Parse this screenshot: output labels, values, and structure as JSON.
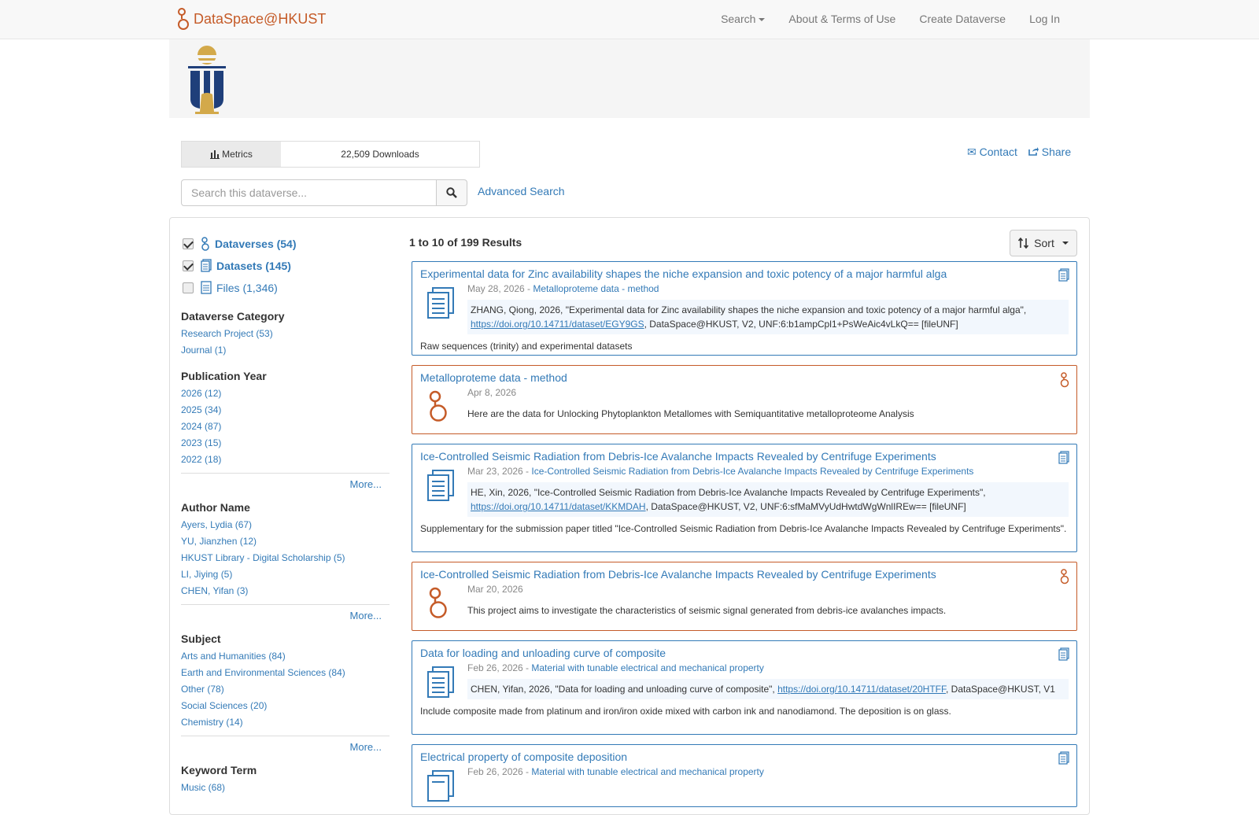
{
  "navbar": {
    "brand": "DataSpace@HKUST",
    "items": [
      "Search",
      "About & Terms of Use",
      "Create Dataverse",
      "Log In"
    ]
  },
  "metrics": {
    "label": "Metrics",
    "downloads": "22,509 Downloads"
  },
  "actions": {
    "contact": "Contact",
    "share": "Share"
  },
  "search": {
    "placeholder": "Search this dataverse...",
    "advanced": "Advanced Search"
  },
  "types": [
    {
      "label": "Dataverses (54)",
      "checked": true
    },
    {
      "label": "Datasets (145)",
      "checked": true
    },
    {
      "label": "Files (1,346)",
      "checked": false
    }
  ],
  "facets": [
    {
      "title": "Dataverse Category",
      "items": [
        "Research Project (53)",
        "Journal (1)"
      ],
      "more": ""
    },
    {
      "title": "Publication Year",
      "items": [
        "2026 (12)",
        "2025 (34)",
        "2024 (87)",
        "2023 (15)",
        "2022 (18)"
      ],
      "more": "More..."
    },
    {
      "title": "Author Name",
      "items": [
        "Ayers, Lydia (67)",
        "YU, Jianzhen (12)",
        "HKUST Library - Digital Scholarship (5)",
        "LI, Jiying (5)",
        "CHEN, Yifan (3)"
      ],
      "more": "More..."
    },
    {
      "title": "Subject",
      "items": [
        "Arts and Humanities (84)",
        "Earth and Environmental Sciences (84)",
        "Other (78)",
        "Social Sciences (20)",
        "Chemistry (14)"
      ],
      "more": "More..."
    },
    {
      "title": "Keyword Term",
      "items": [
        "Music (68)"
      ],
      "more": ""
    }
  ],
  "results": {
    "count": "1 to 10 of 199 Results",
    "sort": "Sort",
    "items": [
      {
        "kind": "dataset",
        "title": "Experimental data for Zinc availability shapes the niche expansion and toxic potency of a major harmful alga",
        "date": "May 28, 2026 - ",
        "parent": "Metalloproteme data - method",
        "cite_pre": "ZHANG, Qiong, 2026, \"Experimental data for Zinc availability shapes the niche expansion and toxic potency of a major harmful alga\", ",
        "doi": "https://doi.org/10.14711/dataset/EGY9GS",
        "cite_post": ", DataSpace@HKUST, V2, UNF:6:b1ampCpl1+PsWeAic4vLkQ== [fileUNF]",
        "desc": "Raw sequences (trinity) and experimental datasets"
      },
      {
        "kind": "dataverse",
        "title": "Metalloproteme data - method",
        "date": "Apr 8, 2026",
        "desc": "Here are the data for Unlocking Phytoplankton Metallomes with Semiquantitative metalloproteome Analysis"
      },
      {
        "kind": "dataset",
        "title": "Ice-Controlled Seismic Radiation from Debris-Ice Avalanche Impacts Revealed by Centrifuge Experiments",
        "date": "Mar 23, 2026 - ",
        "parent": "Ice-Controlled Seismic Radiation from Debris-Ice Avalanche Impacts Revealed by Centrifuge Experiments",
        "cite_pre": "HE, Xin, 2026, \"Ice-Controlled Seismic Radiation from Debris-Ice Avalanche Impacts Revealed by Centrifuge Experiments\", ",
        "doi": "https://doi.org/10.14711/dataset/KKMDAH",
        "cite_post": ", DataSpace@HKUST, V2, UNF:6:sfMaMVyUdHwtdWgWnlIREw== [fileUNF]",
        "desc": "Supplementary for the submission paper titled \"Ice-Controlled Seismic Radiation from Debris-Ice Avalanche Impacts Revealed by Centrifuge Experiments\"."
      },
      {
        "kind": "dataverse",
        "title": "Ice-Controlled Seismic Radiation from Debris-Ice Avalanche Impacts Revealed by Centrifuge Experiments",
        "date": "Mar 20, 2026",
        "desc": "This project aims to investigate the characteristics of seismic signal generated from debris-ice avalanches impacts."
      },
      {
        "kind": "dataset",
        "title": "Data for loading and unloading curve of composite",
        "date": "Feb 26, 2026 - ",
        "parent": "Material with tunable electrical and mechanical property",
        "cite_pre": "CHEN, Yifan, 2026, \"Data for loading and unloading curve of composite\", ",
        "doi": "https://doi.org/10.14711/dataset/20HTFF",
        "cite_post": ", DataSpace@HKUST, V1",
        "desc": "Include composite made from platinum and iron/iron oxide mixed with carbon ink and nanodiamond. The deposition is on glass."
      },
      {
        "kind": "dataset",
        "title": "Electrical property of composite deposition",
        "date": "Feb 26, 2026 - ",
        "parent": "Material with tunable electrical and mechanical property"
      }
    ]
  }
}
